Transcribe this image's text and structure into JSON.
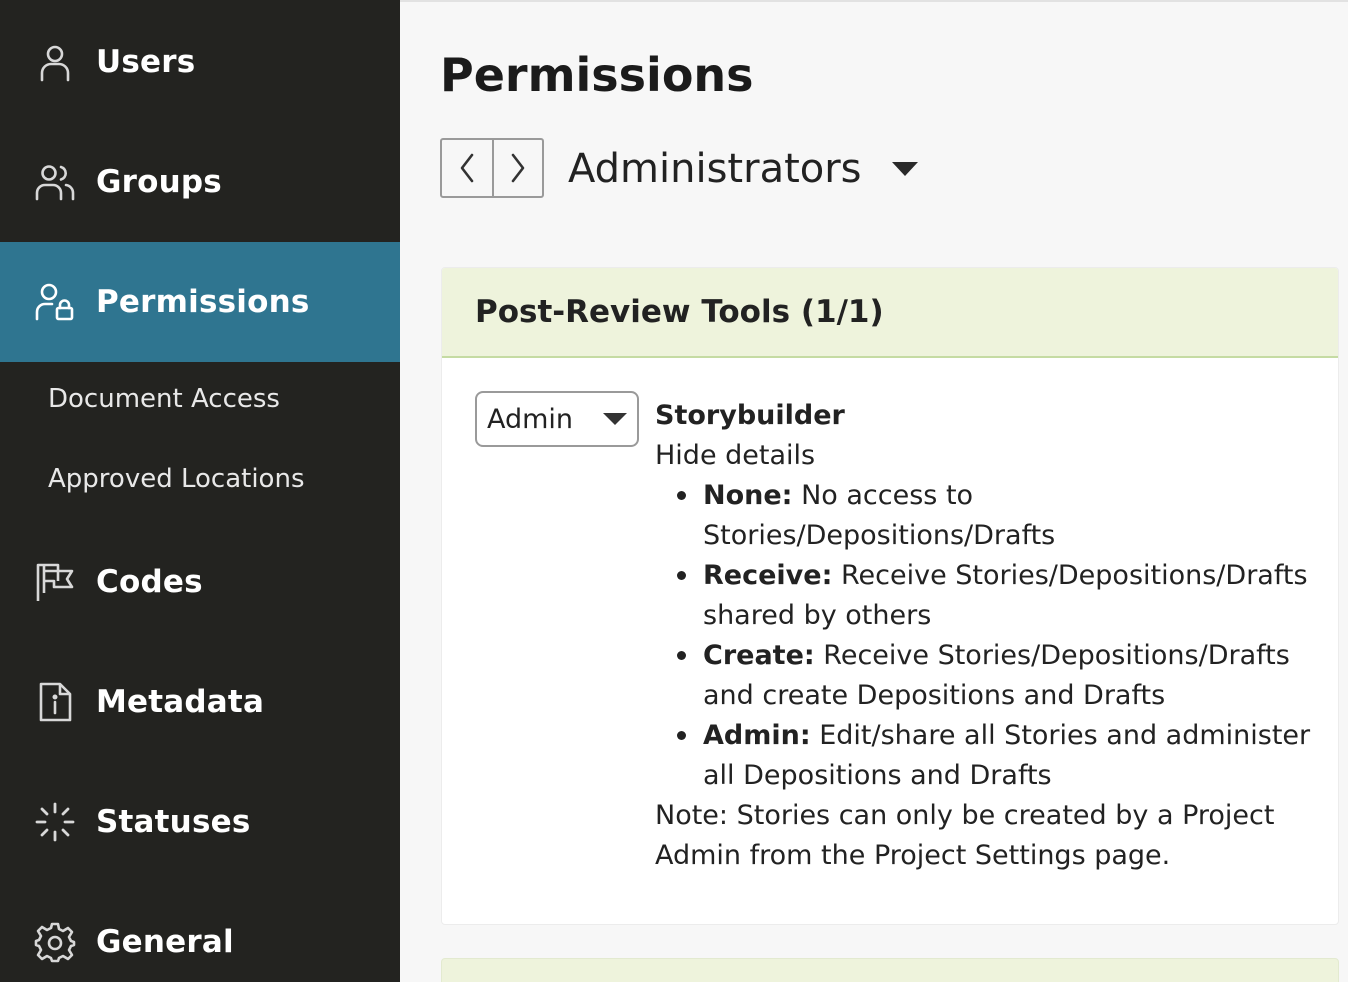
{
  "sidebar": {
    "items": [
      {
        "label": "Users",
        "icon": "user-icon"
      },
      {
        "label": "Groups",
        "icon": "users-icon"
      },
      {
        "label": "Permissions",
        "icon": "user-lock-icon",
        "active": true
      },
      {
        "label": "Codes",
        "icon": "flag-icon"
      },
      {
        "label": "Metadata",
        "icon": "file-info-icon"
      },
      {
        "label": "Statuses",
        "icon": "loader-icon"
      },
      {
        "label": "General",
        "icon": "gear-icon"
      }
    ],
    "sub_items": [
      {
        "label": "Document Access"
      },
      {
        "label": "Approved Locations"
      }
    ]
  },
  "main": {
    "title": "Permissions",
    "group_name": "Administrators",
    "panel": {
      "title": "Post-Review Tools (1/1)",
      "role_value": "Admin",
      "tool_name": "Storybuilder",
      "toggle_label": "Hide details",
      "levels": [
        {
          "name": "None:",
          "text": "No access to Stories/Depositions/Drafts"
        },
        {
          "name": "Receive:",
          "text": "Receive Stories/Depositions/Drafts shared by others"
        },
        {
          "name": "Create:",
          "text": "Receive Stories/Depositions/Drafts and create Depositions and Drafts"
        },
        {
          "name": "Admin:",
          "text": "Edit/share all Stories and administer all Depositions and Drafts"
        }
      ],
      "note": "Note: Stories can only be created by a Project Admin from the Project Settings page."
    }
  },
  "colors": {
    "sidebar_bg": "#232320",
    "active_bg": "#2f7590",
    "panel_header_bg": "#eef3dc",
    "panel_header_border": "#c5dba3"
  }
}
